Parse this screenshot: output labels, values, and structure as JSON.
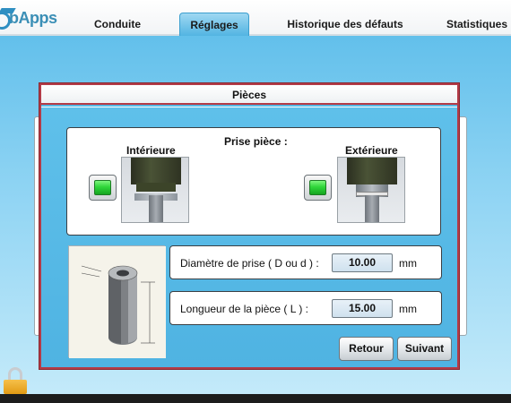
{
  "app": {
    "logo_text": "bApps"
  },
  "nav": {
    "tabs": [
      {
        "label": "Conduite",
        "active": false
      },
      {
        "label": "Réglages",
        "active": true
      },
      {
        "label": "Historique des défauts",
        "active": false
      },
      {
        "label": "Statistiques",
        "active": false
      }
    ]
  },
  "dialog": {
    "title": "Pièces",
    "prise": {
      "title": "Prise pièce :",
      "interieure_label": "Intérieure",
      "exterieure_label": "Extérieure",
      "interieure_selected": true,
      "exterieure_selected": true
    },
    "fields": {
      "diametre": {
        "label": "Diamètre de prise ( D ou d ) :",
        "value": "10.00",
        "unit": "mm"
      },
      "longueur": {
        "label": "Longueur de la pièce  ( L ) :",
        "value": "15.00",
        "unit": "mm"
      }
    },
    "buttons": {
      "retour": "Retour",
      "suivant": "Suivant"
    }
  },
  "colors": {
    "accent": "#52b4e2",
    "dialog_border": "#b33b47",
    "led_on": "#2fd63a",
    "lock": "#e19a14"
  },
  "icons": {
    "logo": "obapps-logo",
    "lock": "lock-icon"
  }
}
